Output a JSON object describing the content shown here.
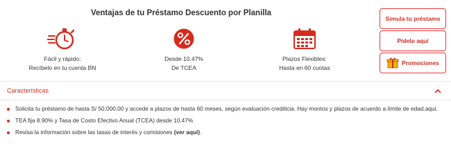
{
  "title": "Ventajas de tu Préstamo Descuento por Planilla",
  "features": [
    {
      "icon": "stopwatch-icon",
      "line1": "Fácil y rápido:",
      "line2": "Recíbelo en tu cuenta BN"
    },
    {
      "icon": "percent-icon",
      "line1": "Desde 10.47%",
      "line2": "De TCEA"
    },
    {
      "icon": "calendar-icon",
      "line1": "Plazos Flexibles:",
      "line2": "Hasta en 60 cuotas"
    }
  ],
  "buttons": {
    "simulate": "Simula tu préstamo",
    "request": "Pídelo aquí",
    "promotions": "Promociones"
  },
  "accordion": {
    "title": "Características",
    "items": [
      "Solicita tu préstamo de hasta S/ 50,000.00 y accede a plazos de hasta 60 meses, según evaluación crediticia. Hay montos y plazos de acuerdo a límite de edad.aqui.",
      "TEA fija 8.90% y Tasa de Costo Efectivo Anual (TCEA) desde 10.47%"
    ],
    "last_item_prefix": "Revisa la información sobre las tasas de interés y comisiones ",
    "last_item_link": "(ver aquí)",
    "last_item_suffix": "."
  },
  "colors": {
    "accent": "#d52b1e",
    "border": "#e5383b",
    "gift": "#f2b705"
  }
}
